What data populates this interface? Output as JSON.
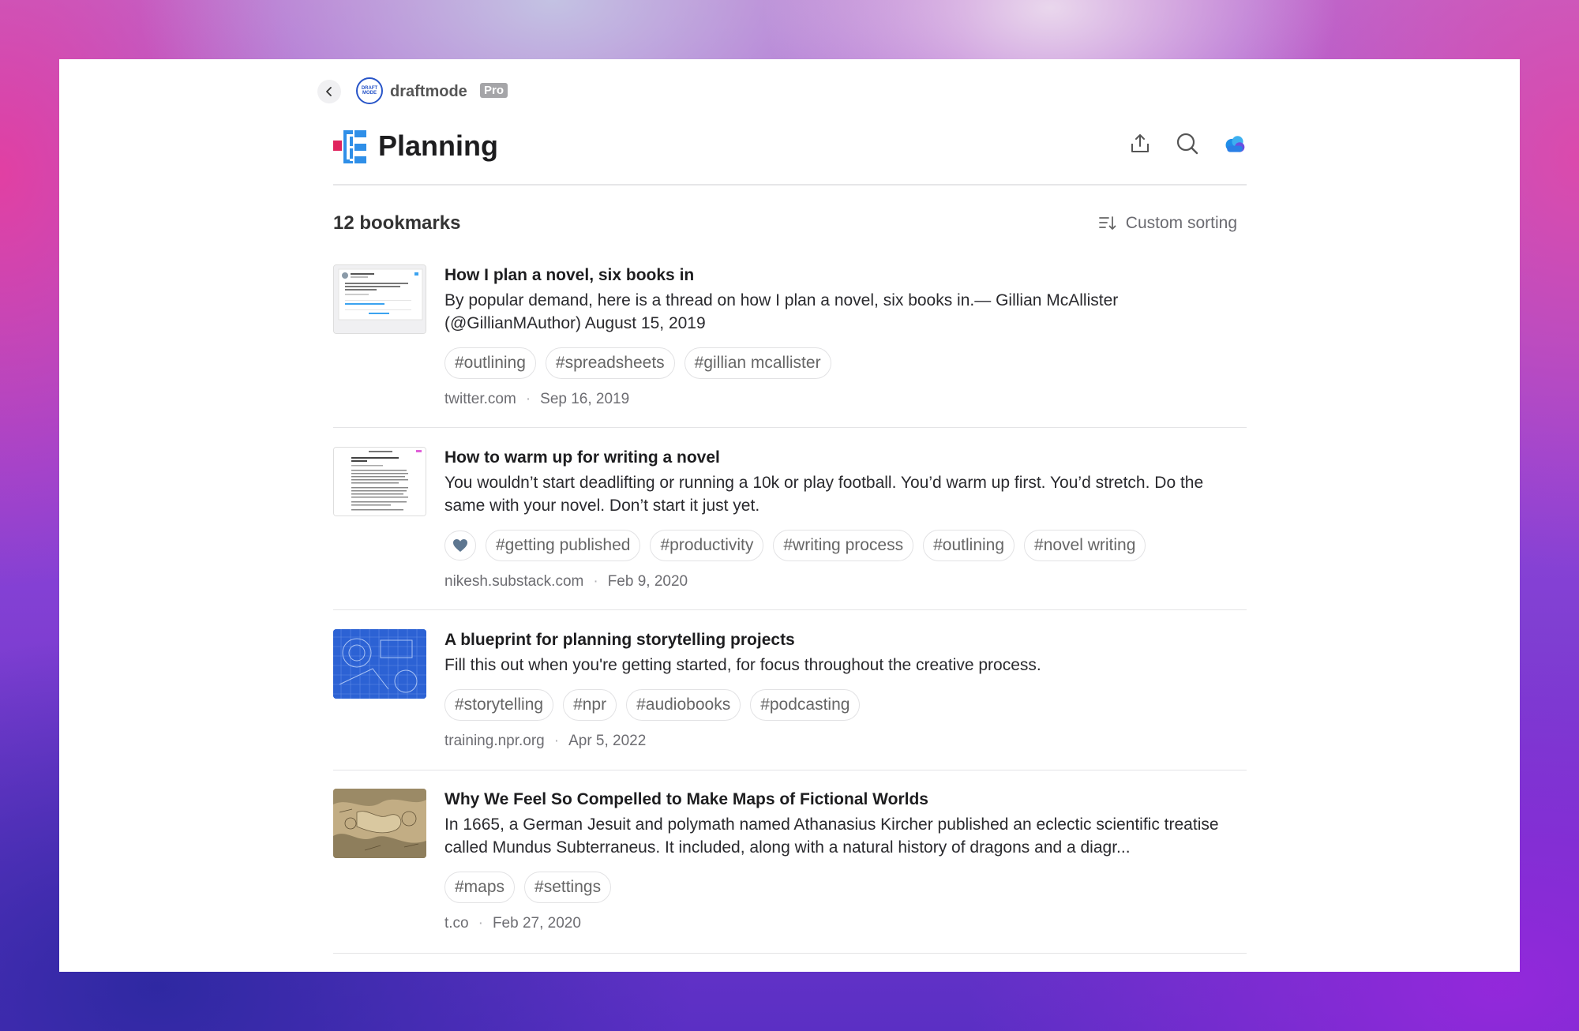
{
  "header": {
    "brand": "draftmode",
    "badge": "Pro",
    "logo_text": "DRAFT MODE",
    "title": "Planning"
  },
  "toolbar": {
    "icons": [
      "share-icon",
      "search-icon",
      "cloud-icon"
    ]
  },
  "list_header": {
    "count_label": "12 bookmarks",
    "sort_label": "Custom sorting"
  },
  "colors": {
    "accent_red": "#e0245e",
    "accent_blue": "#2f8fe8",
    "heart": "#5d7690"
  },
  "bookmarks": [
    {
      "title": "How I plan a novel, six books in",
      "description": "By popular demand, here is a thread on how I plan a novel, six books in.— Gillian McAllister (@GillianMAuthor) August 15, 2019",
      "tags": [
        "#outlining",
        "#spreadsheets",
        "#gillian mcallister"
      ],
      "favorite": false,
      "domain": "twitter.com",
      "date": "Sep 16, 2019"
    },
    {
      "title": "How to warm up for writing a novel",
      "description": "You wouldn’t start deadlifting or running a 10k or play football. You’d warm up first. You’d stretch. Do the same with your novel. Don’t start it just yet.",
      "tags": [
        "#getting published",
        "#productivity",
        "#writing process",
        "#outlining",
        "#novel writing"
      ],
      "favorite": true,
      "domain": "nikesh.substack.com",
      "date": "Feb 9, 2020"
    },
    {
      "title": "A blueprint for planning storytelling projects",
      "description": "Fill this out when you're getting started, for focus throughout the creative process.",
      "tags": [
        "#storytelling",
        "#npr",
        "#audiobooks",
        "#podcasting"
      ],
      "favorite": false,
      "domain": "training.npr.org",
      "date": "Apr 5, 2022"
    },
    {
      "title": "Why We Feel So Compelled to Make Maps of Fictional Worlds",
      "description": "In 1665, a German Jesuit and polymath named Athanasius Kircher published an eclectic scientific treatise called Mundus Subterraneus. It included, along with a natural history of dragons and a diagr...",
      "tags": [
        "#maps",
        "#settings"
      ],
      "favorite": false,
      "domain": "t.co",
      "date": "Feb 27, 2020"
    }
  ]
}
